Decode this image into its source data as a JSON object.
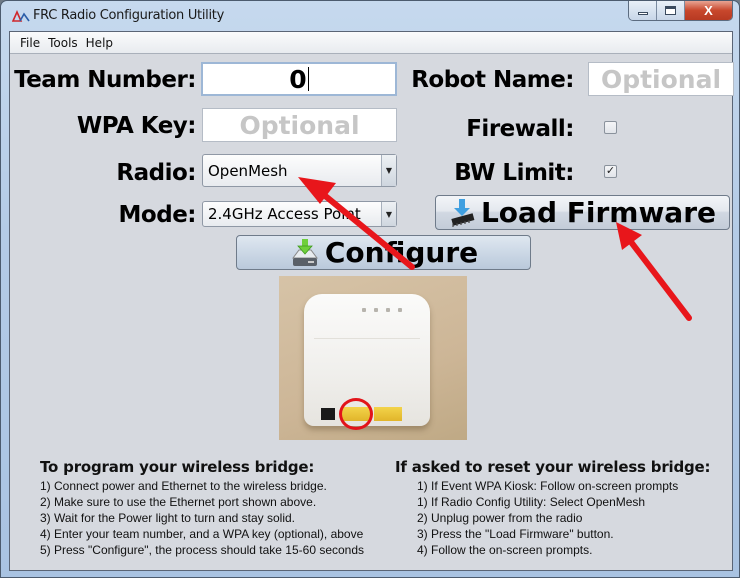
{
  "window": {
    "title": "FRC Radio Configuration Utility",
    "app_icon": "frc-logo-icon",
    "controls": {
      "minimize": "minimize-icon",
      "maximize": "maximize-icon",
      "close": "close-icon",
      "close_glyph": "X"
    }
  },
  "menubar": {
    "items": [
      {
        "label": "File"
      },
      {
        "label": "Tools"
      },
      {
        "label": "Help"
      }
    ]
  },
  "form": {
    "team_number": {
      "label": "Team Number:",
      "value": "0"
    },
    "wpa_key": {
      "label": "WPA Key:",
      "placeholder": "Optional",
      "value": ""
    },
    "radio": {
      "label": "Radio:",
      "selected": "OpenMesh",
      "arrow": "▼"
    },
    "mode": {
      "label": "Mode:",
      "selected": "2.4GHz Access Point",
      "arrow": "▼"
    },
    "robot_name": {
      "label": "Robot Name:",
      "placeholder": "Optional",
      "value": ""
    },
    "firewall": {
      "label": "Firewall:",
      "checked": false,
      "mark": ""
    },
    "bw_limit": {
      "label": "BW Limit:",
      "checked": true,
      "mark": "✓"
    }
  },
  "buttons": {
    "load_firmware": {
      "label": "Load Firmware",
      "icon": "download-chip-icon"
    },
    "configure": {
      "label": "Configure",
      "icon": "download-drive-icon"
    }
  },
  "image": {
    "description": "OpenMesh radio with Ethernet port circled",
    "icon": "radio-photo"
  },
  "instructions": {
    "program": {
      "title": "To program your wireless bridge:",
      "steps": [
        "1) Connect power and Ethernet to the wireless bridge.",
        "2) Make sure to use the Ethernet port shown above.",
        "3) Wait for the Power light to turn and stay solid.",
        "4) Enter your team number, and a WPA key (optional), above",
        "5) Press \"Configure\", the process should take 15-60 seconds"
      ]
    },
    "reset": {
      "title": "If asked to reset your wireless bridge:",
      "steps": [
        "1) If Event WPA Kiosk: Follow on-screen prompts",
        "1) If Radio Config Utility: Select OpenMesh",
        "2) Unplug power from the radio",
        "3) Press the \"Load Firmware\" button.",
        "4) Follow the on-screen prompts."
      ]
    }
  },
  "annotations": {
    "arrow_color": "#e8161b",
    "circle_color": "#e2141a"
  }
}
